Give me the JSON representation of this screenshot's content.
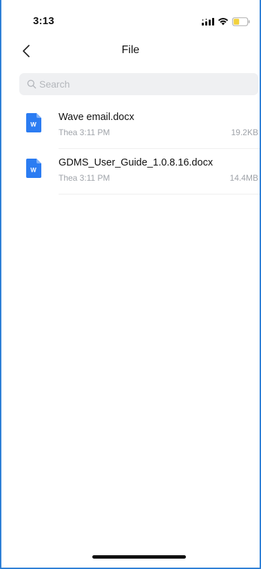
{
  "status_bar": {
    "time": "3:13",
    "icons": [
      "cellular-signal-icon",
      "wifi-icon",
      "battery-icon"
    ],
    "battery_color": "#f2d13c"
  },
  "nav": {
    "back_icon": "chevron-left-icon",
    "title": "File"
  },
  "search": {
    "icon": "search-icon",
    "placeholder": "Search",
    "value": ""
  },
  "files": [
    {
      "name": "Wave email.docx",
      "meta": "Thea 3:11 PM",
      "size": "19.2KB",
      "icon": "word-document-icon",
      "icon_color": "#2b7cf2"
    },
    {
      "name": "GDMS_User_Guide_1.0.8.16.docx",
      "meta": "Thea 3:11 PM",
      "size": "14.4MB",
      "icon": "word-document-icon",
      "icon_color": "#2b7cf2"
    }
  ]
}
